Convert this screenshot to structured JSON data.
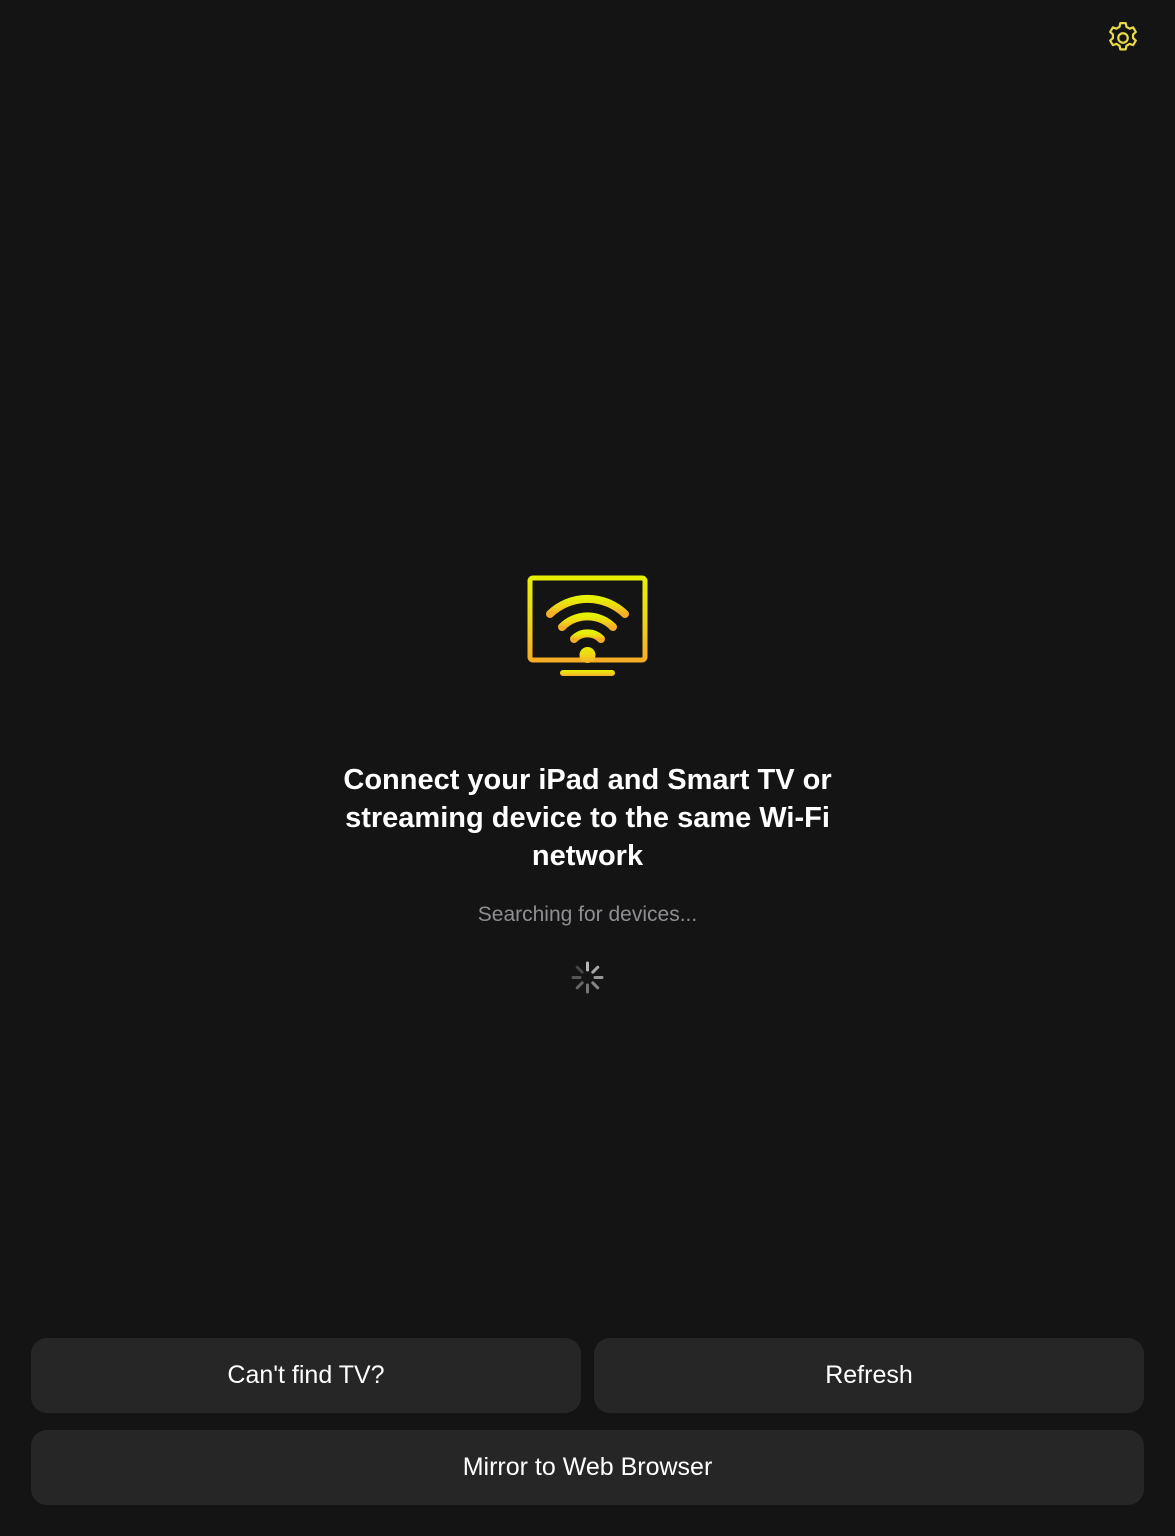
{
  "header": {
    "settings_icon": "gear-icon"
  },
  "hero": {
    "icon": "tv-wifi-icon",
    "headline": "Connect your iPad and Smart TV or streaming device to the same Wi-Fi network",
    "status": "Searching for devices...",
    "spinner_icon": "activity-spinner-icon"
  },
  "actions": {
    "cant_find_label": "Can't find TV?",
    "refresh_label": "Refresh",
    "mirror_label": "Mirror to Web Browser"
  },
  "colors": {
    "background": "#141414",
    "button_background": "#262626",
    "accent_yellow": "#e6f000",
    "accent_orange": "#f5b324",
    "secondary_text": "#8e8e93"
  }
}
